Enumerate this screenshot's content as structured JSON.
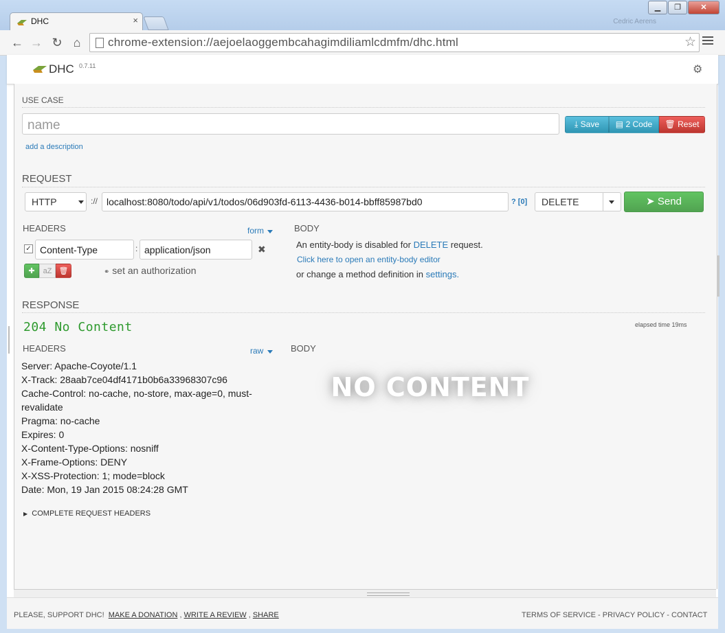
{
  "browser": {
    "tab_title": "DHC",
    "tab_close": "×",
    "url": "chrome-extension://aejoelaoggembcahagimdiliamlcdmfm/dhc.html",
    "window_controls": [
      "▁",
      "❐",
      "✕"
    ],
    "faded_label": "Cedric Aerens"
  },
  "app": {
    "name": "DHC",
    "version": "0.7.11",
    "settings_icon": "gear-icon"
  },
  "use_case": {
    "label": "USE CASE",
    "name_placeholder": "name",
    "add_description": "add a description",
    "save_label": "Save",
    "code_label": "2 Code",
    "reset_label": "Reset"
  },
  "request": {
    "label": "REQUEST",
    "scheme": "HTTP",
    "separator": "://",
    "url": "localhost:8080/todo/api/v1/todos/06d903fd-6113-4436-b014-bbff85987bd0",
    "help": "? [0]",
    "method": "DELETE",
    "send_label": "Send",
    "headers_label": "HEADERS",
    "form_toggle": "form",
    "header_rows": [
      {
        "enabled": true,
        "name": "Content-Type",
        "value": "application/json"
      }
    ],
    "sort_label": "aZ",
    "set_authorization": "set an authorization",
    "body_label": "BODY",
    "body_msg_prefix": "An entity-body is disabled for",
    "body_msg_method": "DELETE",
    "body_msg_suffix": "request.",
    "open_editor": "Click here to open an entity-body editor",
    "change_prefix": "or change a method definition in",
    "settings_link": "settings."
  },
  "response": {
    "label": "RESPONSE",
    "status": "204 No Content",
    "elapsed": "elapsed time 19ms",
    "headers_label": "HEADERS",
    "raw_toggle": "raw",
    "body_label": "BODY",
    "header_lines": [
      "Server: Apache-Coyote/1.1",
      "X-Track: 28aab7ce04df4171b0b6a33968307c96",
      "Cache-Control: no-cache, no-store, max-age=0, must-",
      "revalidate",
      "Pragma: no-cache",
      "Expires: 0",
      "X-Content-Type-Options: nosniff",
      "X-Frame-Options: DENY",
      "X-XSS-Protection: 1; mode=block",
      "Date: Mon, 19 Jan 2015 08:24:28 GMT"
    ],
    "no_content": "NO CONTENT",
    "complete_headers": "COMPLETE REQUEST HEADERS"
  },
  "footer": {
    "support": "PLEASE, SUPPORT DHC!",
    "donation": "MAKE A DONATION",
    "review": "WRITE A REVIEW",
    "share": "SHARE",
    "terms": "TERMS OF SERVICE",
    "privacy": "PRIVACY POLICY",
    "contact": "CONTACT"
  },
  "colors": {
    "accent_info": "#2f96b4",
    "danger": "#bd362f",
    "success": "#51a351",
    "status_green": "#2e9a2e",
    "link": "#2a7ab8"
  }
}
